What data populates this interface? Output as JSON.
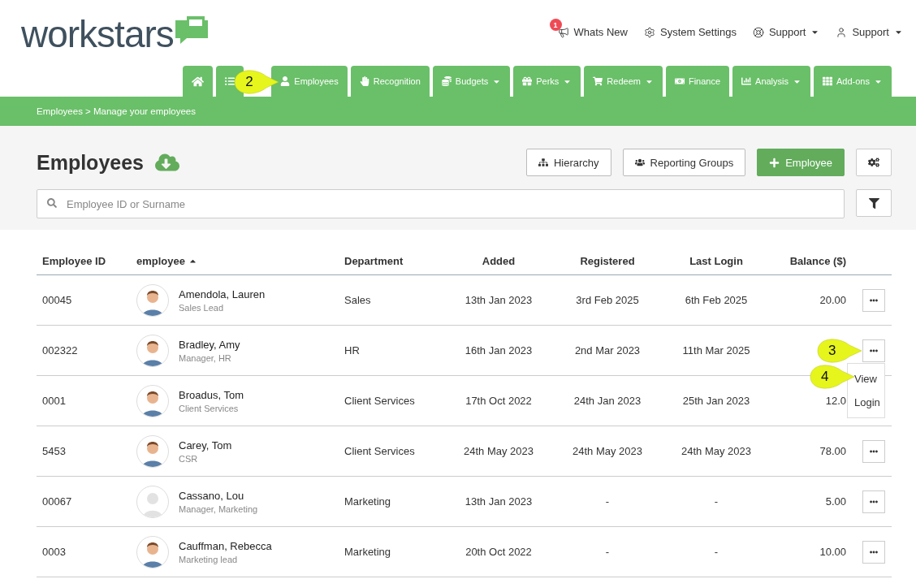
{
  "logo": {
    "text": "workstars"
  },
  "top_links": [
    {
      "label": "Whats New",
      "badge": "1"
    },
    {
      "label": "System Settings",
      "dropdown": false
    },
    {
      "label": "Support",
      "dropdown": true
    },
    {
      "label": "Support",
      "dropdown": true
    }
  ],
  "nav_tabs": [
    {
      "dropdown": false
    },
    {
      "dropdown": false
    },
    {
      "label": "Employees",
      "dropdown": false,
      "callout": "2"
    },
    {
      "label": "Recognition",
      "dropdown": false
    },
    {
      "label": "Budgets",
      "dropdown": true
    },
    {
      "label": "Perks",
      "dropdown": true
    },
    {
      "label": "Redeem",
      "dropdown": true
    },
    {
      "label": "Finance",
      "dropdown": false
    },
    {
      "label": "Analysis",
      "dropdown": true
    },
    {
      "label": "Add-ons",
      "dropdown": true
    }
  ],
  "breadcrumb": "Employees > Manage your employees",
  "page_title": "Employees",
  "toolbar_buttons": [
    {
      "label": "Hierarchy",
      "primary": false
    },
    {
      "label": "Reporting Groups",
      "primary": false
    },
    {
      "label": "Employee",
      "primary": true
    }
  ],
  "search": {
    "placeholder": "Employee ID or Surname"
  },
  "table": {
    "columns": [
      {
        "label": "Employee ID",
        "sorted": false
      },
      {
        "label": "employee",
        "sorted": true
      },
      {
        "label": "Department",
        "sorted": false
      },
      {
        "label": "Added",
        "sorted": false
      },
      {
        "label": "Registered",
        "sorted": false
      },
      {
        "label": "Last Login",
        "sorted": false
      },
      {
        "label": "Balance ($)",
        "sorted": false
      }
    ],
    "rows": [
      {
        "id": "00045",
        "name": "Amendola, Lauren",
        "role": "Sales Lead",
        "avatar": {
          "kind": "illustration"
        },
        "department": "Sales",
        "added": "13th Jan 2023",
        "registered": "3rd Feb 2025",
        "last_login": "6th Feb 2025",
        "balance": "20.00",
        "action_button": true
      },
      {
        "id": "002322",
        "name": "Bradley, Amy",
        "role": "Manager, HR",
        "avatar": {
          "kind": "illustration"
        },
        "department": "HR",
        "added": "16th Jan 2023",
        "registered": "2nd Mar 2023",
        "last_login": "11th Mar 2025",
        "action_button": true,
        "callout": "3",
        "menu": {
          "expanded": true,
          "items": [
            {
              "label": "View",
              "callout": "4"
            },
            {
              "label": "Login"
            }
          ]
        }
      },
      {
        "id": "0001",
        "name": "Broadus, Tom",
        "role": "Client Services",
        "avatar": {
          "kind": "illustration"
        },
        "department": "Client Services",
        "added": "17th Oct 2022",
        "registered": "24th Jan 2023",
        "last_login": "25th Jan 2023",
        "balance": "12.0",
        "action_button": false
      },
      {
        "id": "5453",
        "name": "Carey, Tom",
        "role": "CSR",
        "avatar": {
          "kind": "illustration"
        },
        "department": "Client Services",
        "added": "24th May 2023",
        "registered": "24th May 2023",
        "last_login": "24th May 2023",
        "balance": "78.00",
        "action_button": true
      },
      {
        "id": "00067",
        "name": "Cassano, Lou",
        "role": "Manager, Marketing",
        "avatar": {
          "kind": "placeholder"
        },
        "department": "Marketing",
        "added": "13th Jan 2023",
        "registered": "-",
        "last_login": "-",
        "balance": "5.00",
        "action_button": true
      },
      {
        "id": "0003",
        "name": "Cauffman, Rebecca",
        "role": "Marketing lead",
        "avatar": {
          "kind": "illustration"
        },
        "department": "Marketing",
        "added": "20th Oct 2022",
        "registered": "-",
        "last_login": "-",
        "balance": "10.00",
        "action_button": true
      }
    ]
  }
}
